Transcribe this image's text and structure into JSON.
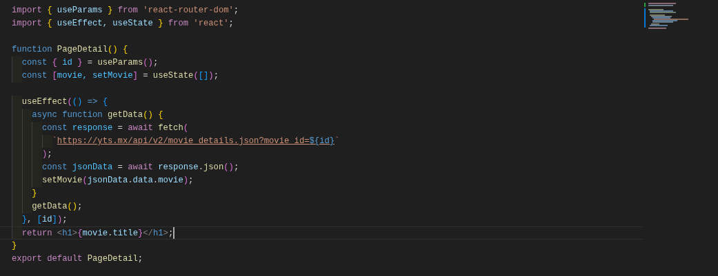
{
  "editor": {
    "lines": [
      {
        "current": false,
        "tokens": [
          {
            "text": "import ",
            "kind": "kw"
          },
          {
            "text": "{",
            "kind": "b1"
          },
          {
            "text": " useParams ",
            "kind": "var"
          },
          {
            "text": "}",
            "kind": "b1"
          },
          {
            "text": " from ",
            "kind": "kw"
          },
          {
            "text": "'react-router-dom'",
            "kind": "str"
          },
          {
            "text": ";",
            "kind": "p"
          }
        ]
      },
      {
        "current": false,
        "tokens": [
          {
            "text": "import ",
            "kind": "kw"
          },
          {
            "text": "{",
            "kind": "b1"
          },
          {
            "text": " useEffect, useState ",
            "kind": "var"
          },
          {
            "text": "}",
            "kind": "b1"
          },
          {
            "text": " from ",
            "kind": "kw"
          },
          {
            "text": "'react'",
            "kind": "str"
          },
          {
            "text": ";",
            "kind": "p"
          }
        ]
      },
      {
        "current": false
      },
      {
        "current": false,
        "tokens": [
          {
            "text": "function ",
            "kind": "st"
          },
          {
            "text": "PageDetail",
            "kind": "fn"
          },
          {
            "text": "()",
            "kind": "b1"
          },
          {
            "text": " {",
            "kind": "b1"
          }
        ]
      },
      {
        "current": false,
        "tokens": [
          {
            "text": "  const ",
            "kind": "st"
          },
          {
            "text": "{",
            "kind": "b2"
          },
          {
            "text": " id ",
            "kind": "cst"
          },
          {
            "text": "}",
            "kind": "b2"
          },
          {
            "text": " = ",
            "kind": "p"
          },
          {
            "text": "useParams",
            "kind": "fn"
          },
          {
            "text": "()",
            "kind": "b2"
          },
          {
            "text": ";",
            "kind": "p"
          }
        ]
      },
      {
        "current": false,
        "tokens": [
          {
            "text": "  const ",
            "kind": "st"
          },
          {
            "text": "[",
            "kind": "b2"
          },
          {
            "text": "movie, setMovie",
            "kind": "cst"
          },
          {
            "text": "]",
            "kind": "b2"
          },
          {
            "text": " = ",
            "kind": "p"
          },
          {
            "text": "useState",
            "kind": "fn"
          },
          {
            "text": "(",
            "kind": "b2"
          },
          {
            "text": "[]",
            "kind": "b3"
          },
          {
            "text": ")",
            "kind": "b2"
          },
          {
            "text": ";",
            "kind": "p"
          }
        ]
      },
      {
        "current": false
      },
      {
        "current": false,
        "tokens": [
          {
            "text": "  useEffect",
            "kind": "fn"
          },
          {
            "text": "(",
            "kind": "b2"
          },
          {
            "text": "()",
            "kind": "b3"
          },
          {
            "text": " => ",
            "kind": "st"
          },
          {
            "text": "{",
            "kind": "b3"
          }
        ]
      },
      {
        "current": false,
        "tokens": [
          {
            "text": "    async function ",
            "kind": "st"
          },
          {
            "text": "getData",
            "kind": "fn"
          },
          {
            "text": "()",
            "kind": "b1"
          },
          {
            "text": " {",
            "kind": "b1"
          }
        ]
      },
      {
        "current": false,
        "tokens": [
          {
            "text": "      const ",
            "kind": "st"
          },
          {
            "text": "response",
            "kind": "cst"
          },
          {
            "text": " = ",
            "kind": "p"
          },
          {
            "text": "await ",
            "kind": "kw"
          },
          {
            "text": "fetch",
            "kind": "fn"
          },
          {
            "text": "(",
            "kind": "b2"
          }
        ]
      },
      {
        "current": false,
        "tokens": [
          {
            "text": "        `",
            "kind": "str"
          },
          {
            "text": "https://yts.mx/api/v2/movie_details.json?movie_id=",
            "kind": "url"
          },
          {
            "text": "${id}",
            "kind": "expr"
          },
          {
            "text": "`",
            "kind": "str"
          }
        ]
      },
      {
        "current": false,
        "tokens": [
          {
            "text": "      )",
            "kind": "b2"
          },
          {
            "text": ";",
            "kind": "p"
          }
        ]
      },
      {
        "current": false,
        "tokens": [
          {
            "text": "      const ",
            "kind": "st"
          },
          {
            "text": "jsonData",
            "kind": "cst"
          },
          {
            "text": " = ",
            "kind": "p"
          },
          {
            "text": "await ",
            "kind": "kw"
          },
          {
            "text": "response",
            "kind": "var"
          },
          {
            "text": ".",
            "kind": "p"
          },
          {
            "text": "json",
            "kind": "fn"
          },
          {
            "text": "()",
            "kind": "b2"
          },
          {
            "text": ";",
            "kind": "p"
          }
        ]
      },
      {
        "current": false,
        "tokens": [
          {
            "text": "      setMovie",
            "kind": "fn"
          },
          {
            "text": "(",
            "kind": "b2"
          },
          {
            "text": "jsonData",
            "kind": "var"
          },
          {
            "text": ".",
            "kind": "p"
          },
          {
            "text": "data",
            "kind": "var"
          },
          {
            "text": ".",
            "kind": "p"
          },
          {
            "text": "movie",
            "kind": "var"
          },
          {
            "text": ")",
            "kind": "b2"
          },
          {
            "text": ";",
            "kind": "p"
          }
        ]
      },
      {
        "current": false,
        "tokens": [
          {
            "text": "    }",
            "kind": "b1"
          }
        ]
      },
      {
        "current": false,
        "tokens": [
          {
            "text": "    getData",
            "kind": "fn"
          },
          {
            "text": "()",
            "kind": "b1"
          },
          {
            "text": ";",
            "kind": "p"
          }
        ]
      },
      {
        "current": false,
        "tokens": [
          {
            "text": "  }",
            "kind": "b3"
          },
          {
            "text": ", ",
            "kind": "p"
          },
          {
            "text": "[",
            "kind": "b3"
          },
          {
            "text": "id",
            "kind": "var"
          },
          {
            "text": "]",
            "kind": "b3"
          },
          {
            "text": ")",
            "kind": "b2"
          },
          {
            "text": ";",
            "kind": "p"
          }
        ]
      },
      {
        "current": true,
        "tokens": [
          {
            "text": "  return ",
            "kind": "kw"
          },
          {
            "text": "<",
            "kind": "tag"
          },
          {
            "text": "h1",
            "kind": "tagname"
          },
          {
            "text": ">",
            "kind": "tag"
          },
          {
            "text": "{",
            "kind": "b2"
          },
          {
            "text": "movie",
            "kind": "var"
          },
          {
            "text": ".",
            "kind": "p"
          },
          {
            "text": "title",
            "kind": "var"
          },
          {
            "text": "}",
            "kind": "b2"
          },
          {
            "text": "</",
            "kind": "tag"
          },
          {
            "text": "h1",
            "kind": "tagname"
          },
          {
            "text": ">",
            "kind": "tag"
          },
          {
            "text": ";",
            "kind": "p"
          }
        ]
      },
      {
        "current": false,
        "tokens": [
          {
            "text": "}",
            "kind": "b1"
          }
        ]
      },
      {
        "current": false,
        "tokens": [
          {
            "text": "export default ",
            "kind": "kw"
          },
          {
            "text": "PageDetail",
            "kind": "fn"
          },
          {
            "text": ";",
            "kind": "p"
          }
        ]
      }
    ]
  }
}
